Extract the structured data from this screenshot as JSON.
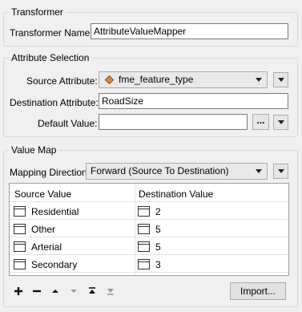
{
  "transformer_group": {
    "title": "Transformer",
    "name_label": "Transformer Name:",
    "name_value": "AttributeValueMapper"
  },
  "attribute_group": {
    "title": "Attribute Selection",
    "source_label": "Source Attribute:",
    "source_value": "fme_feature_type",
    "source_icon": "attribute-diamond-icon",
    "destination_label": "Destination Attribute:",
    "destination_value": "RoadSize",
    "default_label": "Default Value:",
    "default_value": "",
    "ellipsis_label": "..."
  },
  "value_map_group": {
    "title": "Value Map",
    "direction_label": "Mapping Direction:",
    "direction_value": "Forward (Source To Destination)",
    "table": {
      "columns": [
        "Source Value",
        "Destination Value"
      ],
      "rows": [
        {
          "source": "Residential",
          "destination": "2"
        },
        {
          "source": "Other",
          "destination": "5"
        },
        {
          "source": "Arterial",
          "destination": "5"
        },
        {
          "source": "Secondary",
          "destination": "3"
        }
      ]
    },
    "toolbar_icons": [
      "add-icon",
      "remove-icon",
      "move-up-icon",
      "move-down-icon",
      "move-top-icon",
      "move-bottom-icon"
    ],
    "import_label": "Import..."
  }
}
